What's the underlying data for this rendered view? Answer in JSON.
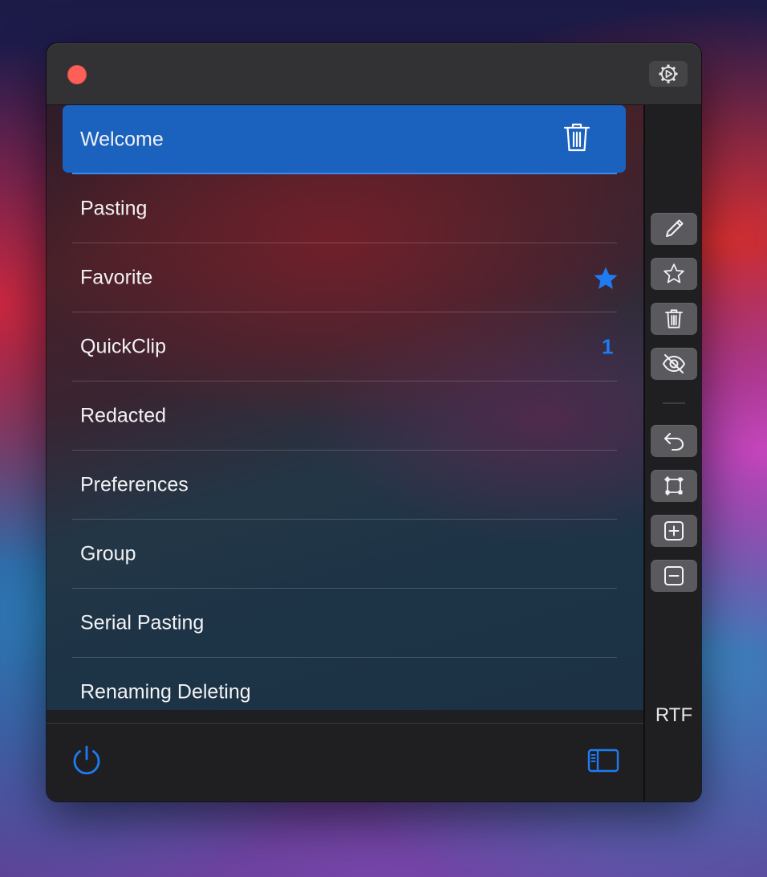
{
  "window": {
    "close_button": "close",
    "settings_icon": "gear-icon"
  },
  "list": {
    "items": [
      {
        "label": "Welcome",
        "selected": true,
        "accessory": "trash-icon"
      },
      {
        "label": "Pasting"
      },
      {
        "label": "Favorite",
        "accessory": "star-icon"
      },
      {
        "label": "QuickClip",
        "badge": "1"
      },
      {
        "label": "Redacted"
      },
      {
        "label": "Preferences"
      },
      {
        "label": "Group"
      },
      {
        "label": "Serial Pasting"
      },
      {
        "label": "Renaming Deleting"
      }
    ]
  },
  "toolbar": {
    "buttons": [
      "pencil-icon",
      "star-icon",
      "trash-icon",
      "eye-slash-icon",
      "undo-icon",
      "transform-icon",
      "plus-square-icon",
      "minus-square-icon"
    ],
    "format_label": "RTF"
  },
  "footer": {
    "power_icon": "power-icon",
    "sidebar_icon": "sidebar-icon"
  },
  "colors": {
    "accent": "#1f7bf2",
    "selection": "#1a62bd",
    "close": "#fe5f57",
    "window_bg": "#1f1f21",
    "titlebar": "#323234"
  }
}
